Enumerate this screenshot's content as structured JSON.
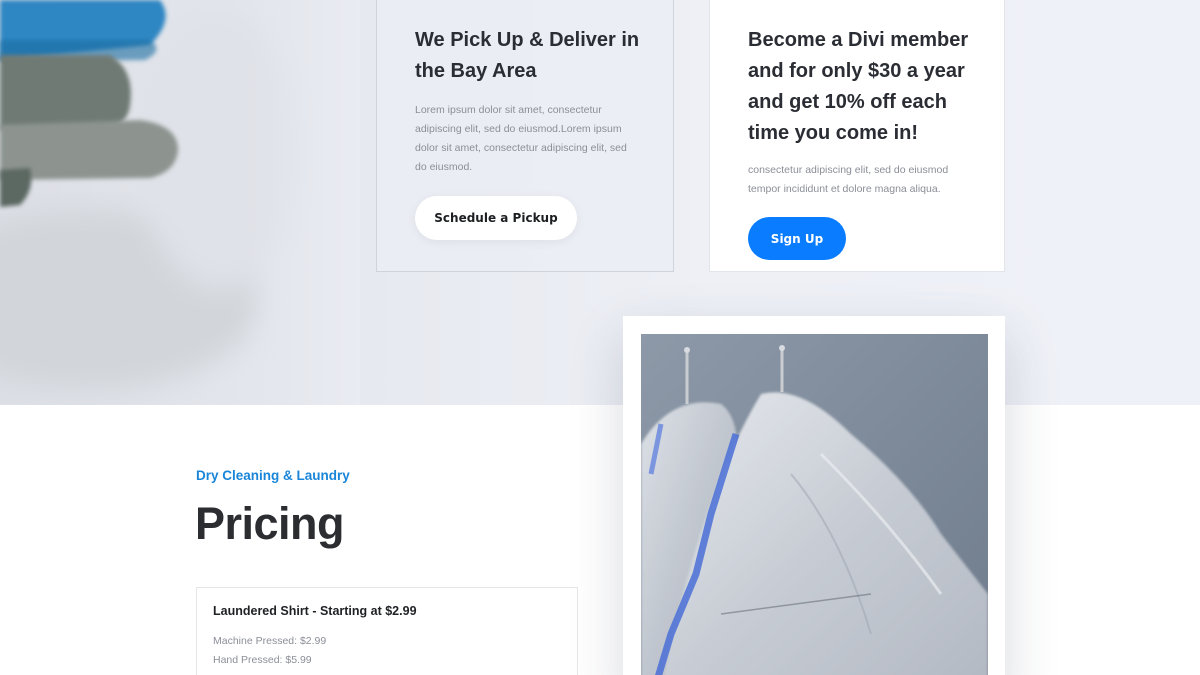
{
  "cards": [
    {
      "title": "We Pick Up & Deliver in the Bay Area",
      "body": "Lorem ipsum dolor sit amet, consectetur adipiscing elit, sed do eiusmod.Lorem ipsum dolor sit amet, consectetur adipiscing elit, sed do eiusmod.",
      "button": "Schedule a Pickup"
    },
    {
      "title": "Become a Divi member and for only $30 a year and get 10% off each time you come in!",
      "body": "consectetur adipiscing elit, sed do eiusmod tempor incididunt et dolore magna aliqua.",
      "button": "Sign Up"
    }
  ],
  "pricing": {
    "eyebrow": "Dry Cleaning & Laundry",
    "title": "Pricing",
    "item": {
      "name": "Laundered Shirt - Starting at $2.99",
      "lines": [
        "Machine Pressed: $2.99",
        "Hand Pressed: $5.99"
      ]
    }
  },
  "colors": {
    "accent_blue": "#0a7cff",
    "eyebrow_blue": "#1a86d9",
    "heading": "#2a2d33",
    "muted_text": "#8b8f98"
  }
}
